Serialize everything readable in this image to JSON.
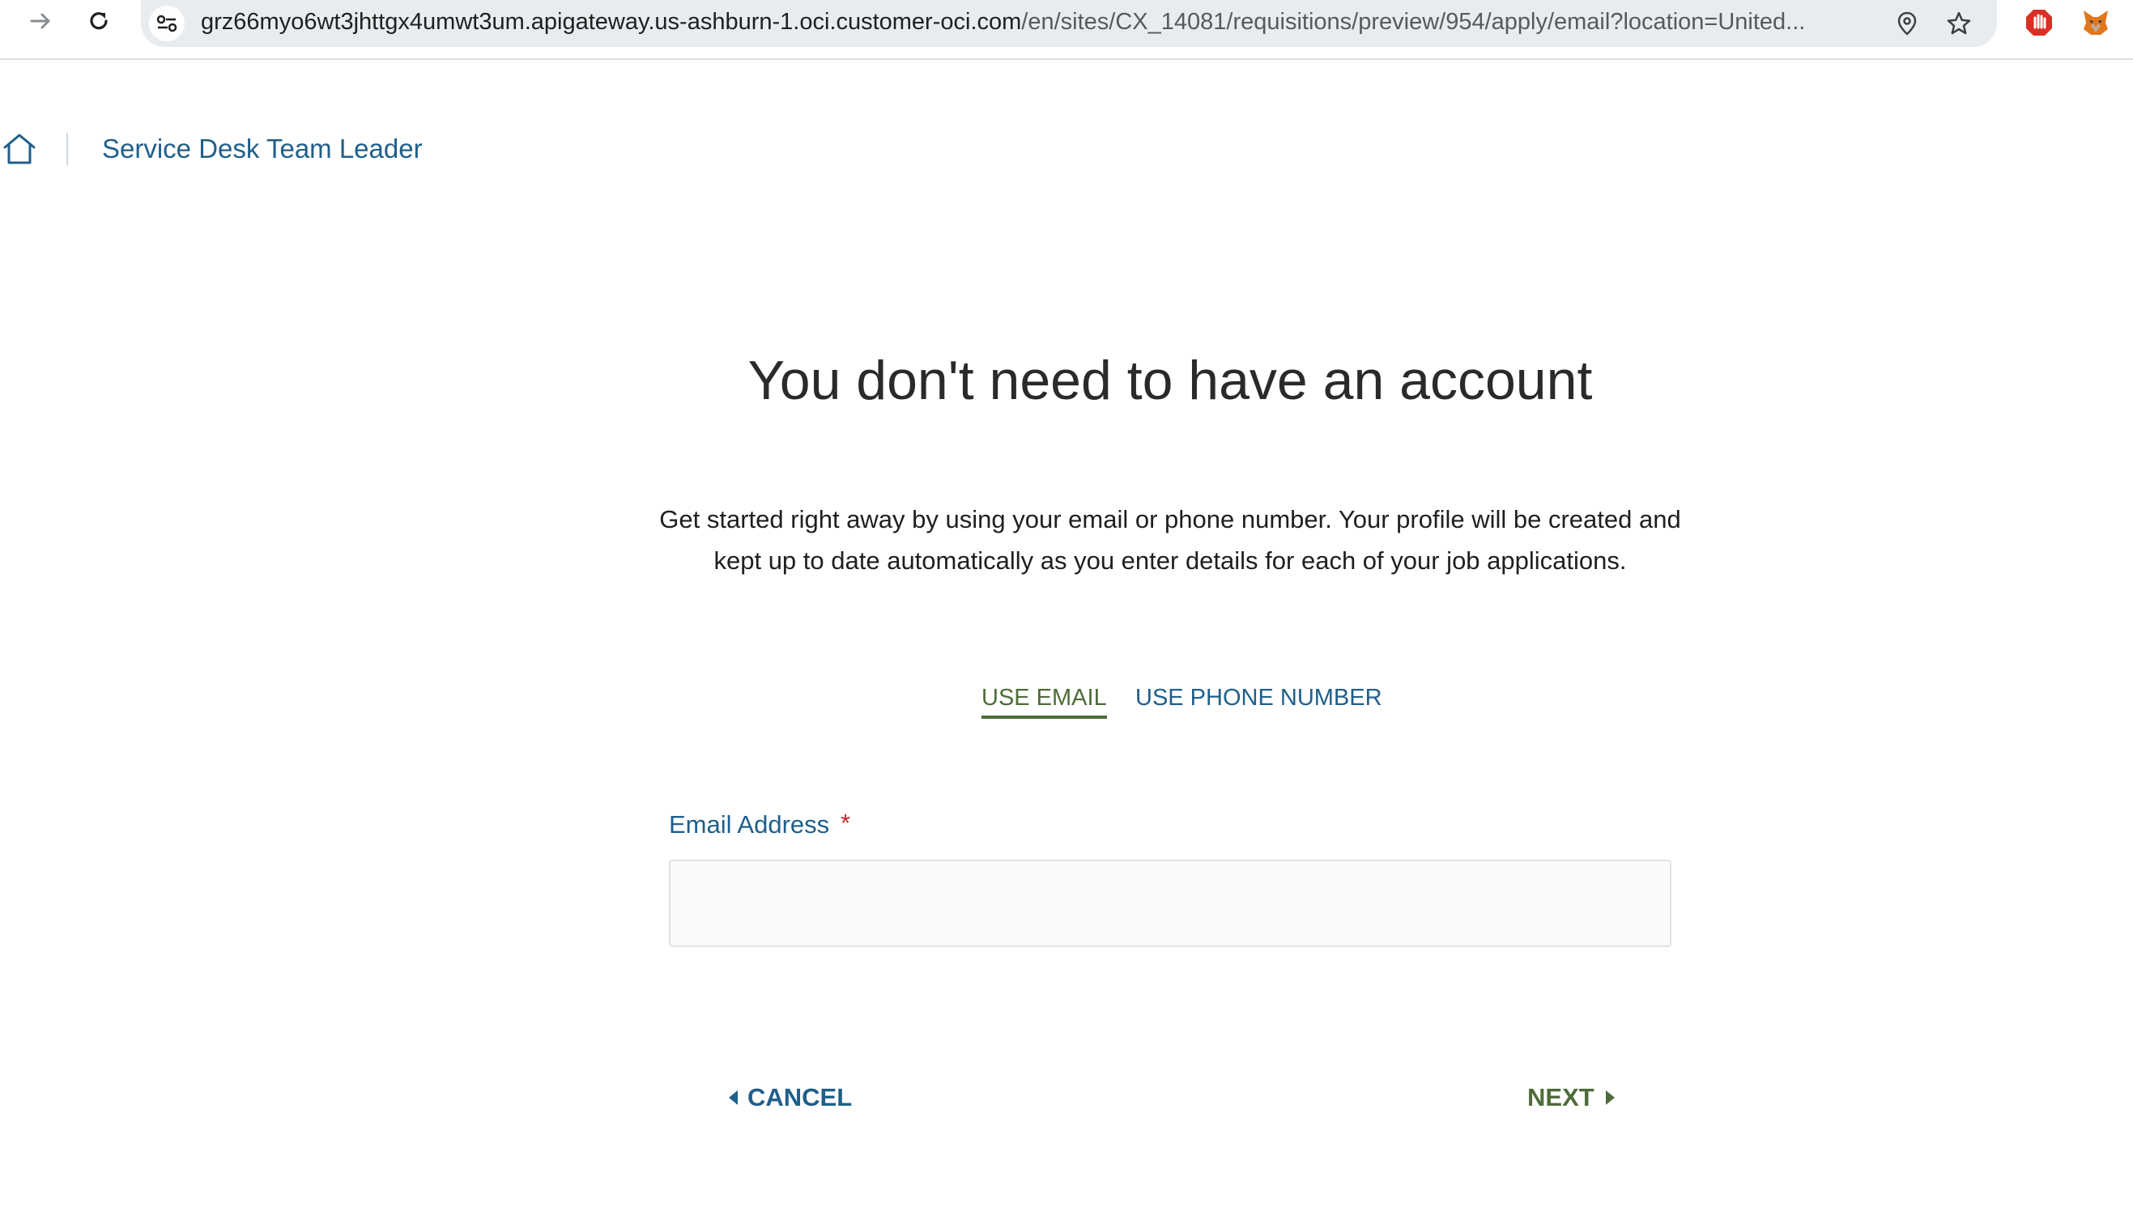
{
  "browser": {
    "url_host": "grz66myo6wt3jhttgx4umwt3um.apigateway.us-ashburn-1.oci.customer-oci.com",
    "url_path": "/en/sites/CX_14081/requisitions/preview/954/apply/email?location=United..."
  },
  "header": {
    "job_title": "Service Desk Team Leader"
  },
  "main": {
    "heading": "You don't need to have an account",
    "intro": "Get started right away by using your email or phone number. Your profile will be created and kept up to date automatically as you enter details for each of your job applications.",
    "tabs": [
      {
        "label": "USE EMAIL",
        "selected": true
      },
      {
        "label": "USE PHONE NUMBER",
        "selected": false
      }
    ],
    "email_field": {
      "label": "Email Address",
      "required_marker": "*",
      "value": ""
    }
  },
  "actions": {
    "cancel_label": "CANCEL",
    "next_label": "NEXT"
  },
  "colors": {
    "link_blue": "#1f5f8b",
    "active_green": "#4e6c3a",
    "required_red": "#c0282c"
  }
}
